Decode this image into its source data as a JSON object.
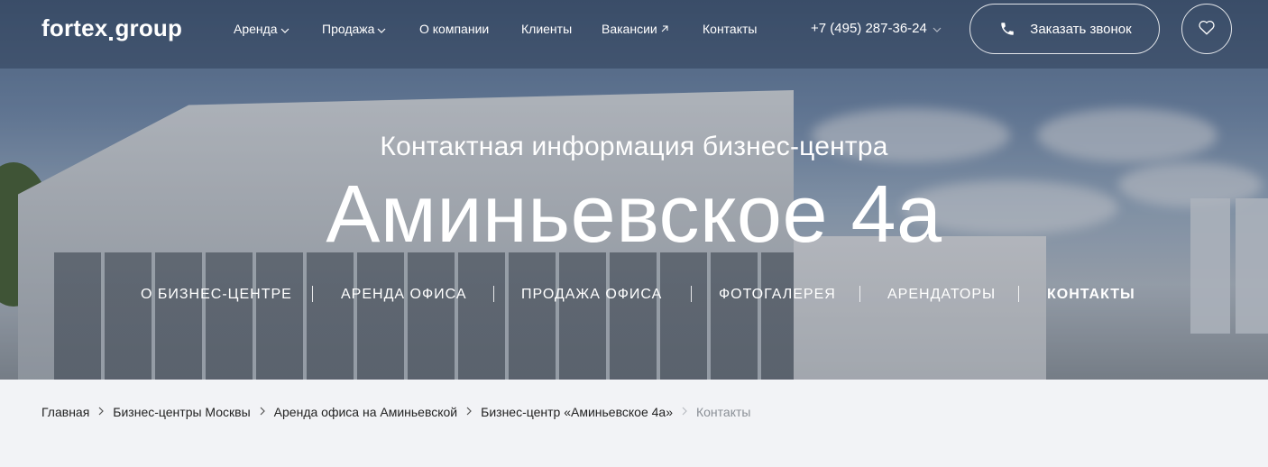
{
  "header": {
    "logo_left": "fortex",
    "logo_right": "group",
    "nav": [
      {
        "label": "Аренда",
        "has_dropdown": true
      },
      {
        "label": "Продажа",
        "has_dropdown": true
      },
      {
        "label": "О компании",
        "has_dropdown": false
      },
      {
        "label": "Клиенты",
        "has_dropdown": false
      },
      {
        "label": "Вакансии",
        "external": true
      },
      {
        "label": "Контакты",
        "has_dropdown": false
      }
    ],
    "phone": "+7 (495) 287-36-24",
    "callback_label": "Заказать звонок",
    "icons": {
      "phone": "phone-icon",
      "favorites": "heart-icon",
      "dropdown": "chevron-down-icon",
      "external": "arrow-up-right-icon"
    }
  },
  "hero": {
    "subtitle": "Контактная информация бизнес-центра",
    "title": "Аминьевское 4а",
    "tabs": [
      {
        "label": "О БИЗНЕС-ЦЕНТРЕ",
        "active": false
      },
      {
        "label": "АРЕНДА ОФИСА",
        "active": false
      },
      {
        "label": "ПРОДАЖА ОФИСА",
        "active": false
      },
      {
        "label": "ФОТОГАЛЕРЕЯ",
        "active": false
      },
      {
        "label": "АРЕНДАТОРЫ",
        "active": false
      },
      {
        "label": "КОНТАКТЫ",
        "active": true
      }
    ]
  },
  "breadcrumbs": [
    "Главная",
    "Бизнес-центры Москвы",
    "Аренда офиса на Аминьевской",
    "Бизнес-центр «Аминьевское 4а»",
    "Контакты"
  ],
  "colors": {
    "breadcrumb_bg": "#f2f3f6",
    "text_on_hero": "#ffffff",
    "breadcrumb_current": "#8a8f96"
  }
}
